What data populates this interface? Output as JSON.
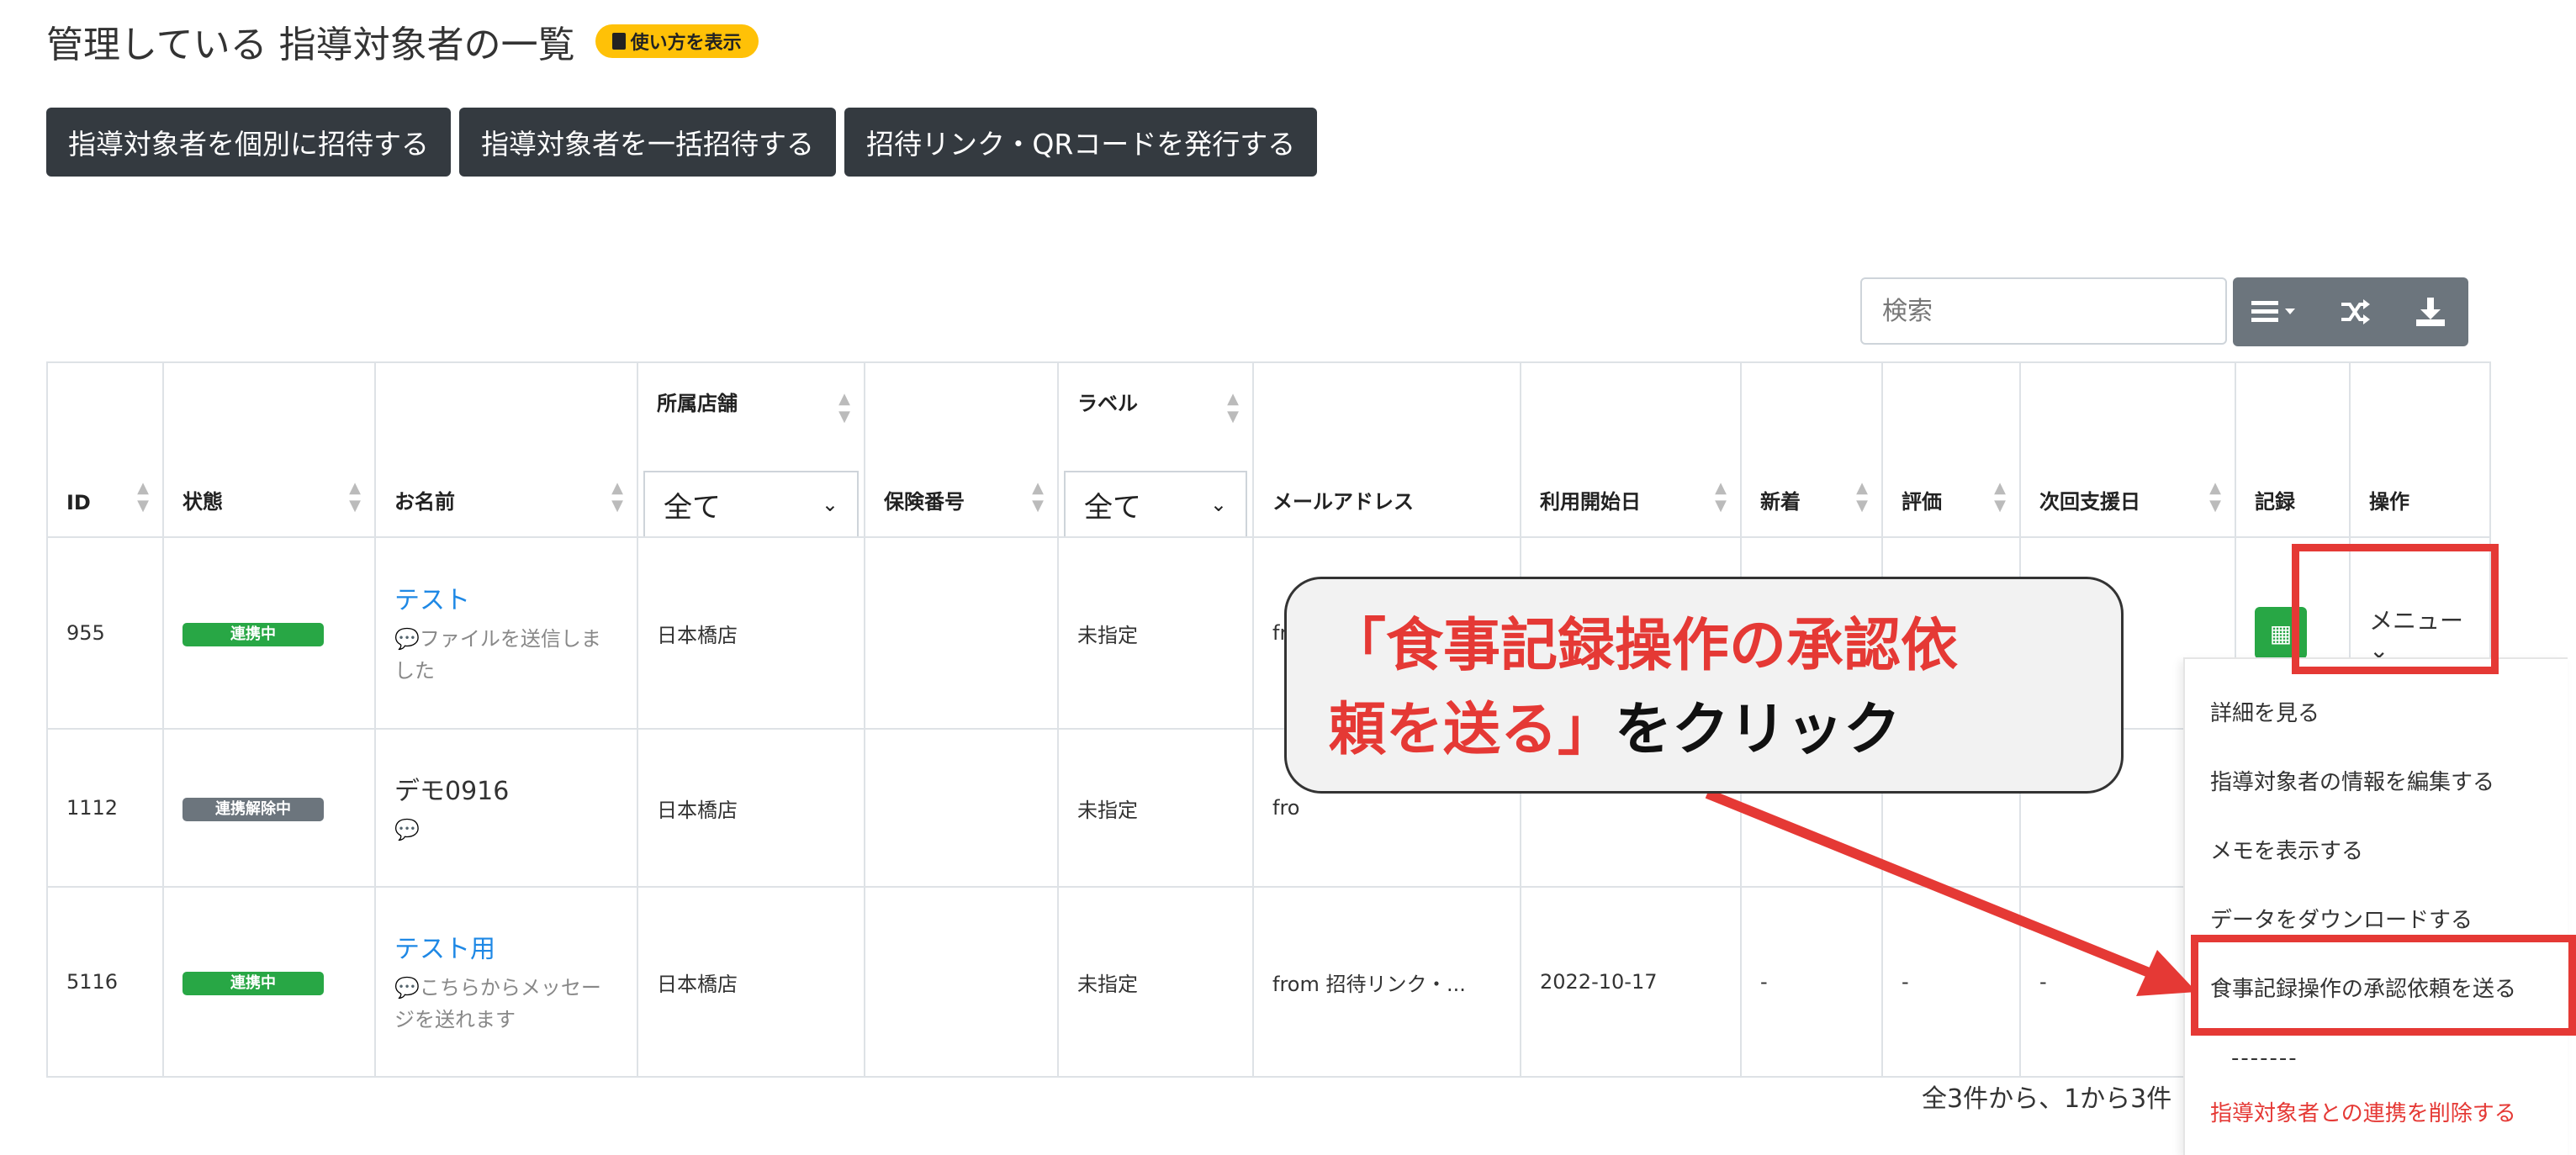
{
  "page": {
    "title": "管理している 指導対象者の一覧",
    "help_badge": "使い方を表示"
  },
  "toolbar": {
    "buttons": [
      "指導対象者を個別に招待する",
      "指導対象者を一括招待する",
      "招待リンク・QRコードを発行する"
    ],
    "search_placeholder": "検索",
    "icons": [
      "list-icon",
      "shuffle-icon",
      "download-icon"
    ]
  },
  "table": {
    "columns": [
      "ID",
      "状態",
      "お名前",
      "所属店舗",
      "保険番号",
      "ラベル",
      "メールアドレス",
      "利用開始日",
      "新着",
      "評価",
      "次回支援日",
      "記録",
      "操作"
    ],
    "store_filter": "全て",
    "label_filter": "全て",
    "rows": [
      {
        "id": "955",
        "status": "連携中",
        "name": "テスト",
        "sub": "ファイルを送信しました",
        "store": "日本橋店",
        "label": "未指定",
        "email": "fro",
        "start": "",
        "new": "",
        "rating": "",
        "next": ""
      },
      {
        "id": "1112",
        "status": "連携解除中",
        "name": "デモ0916",
        "sub": "",
        "store": "日本橋店",
        "label": "未指定",
        "email": "fro",
        "start": "",
        "new": "",
        "rating": "",
        "next": ""
      },
      {
        "id": "5116",
        "status": "連携中",
        "name": "テスト用",
        "sub": "こちらからメッセージを送れます",
        "store": "日本橋店",
        "label": "未指定",
        "email": "from 招待リンク・...",
        "start": "2022-10-17",
        "new": "-",
        "rating": "-",
        "next": "-"
      }
    ],
    "menu_label": "メニュー"
  },
  "dropdown": {
    "items": [
      "詳細を見る",
      "指導対象者の情報を編集する",
      "メモを表示する",
      "データをダウンロードする",
      "食事記録操作の承認依頼を送る"
    ],
    "divider": "-------",
    "danger_item": "指導対象者との連携を削除する"
  },
  "callout": {
    "line1_red": "「食事記録操作の承認依",
    "line2_red": "頼を送る」",
    "line2_black": "をクリック"
  },
  "pager": {
    "text": "全3件から、1から3件"
  },
  "colors": {
    "accent_red": "#e53935",
    "dark_button": "#343a40",
    "badge_green": "#28a745",
    "badge_gray": "#6c757d",
    "link_blue": "#1e88e5",
    "yellow": "#ffc107"
  }
}
